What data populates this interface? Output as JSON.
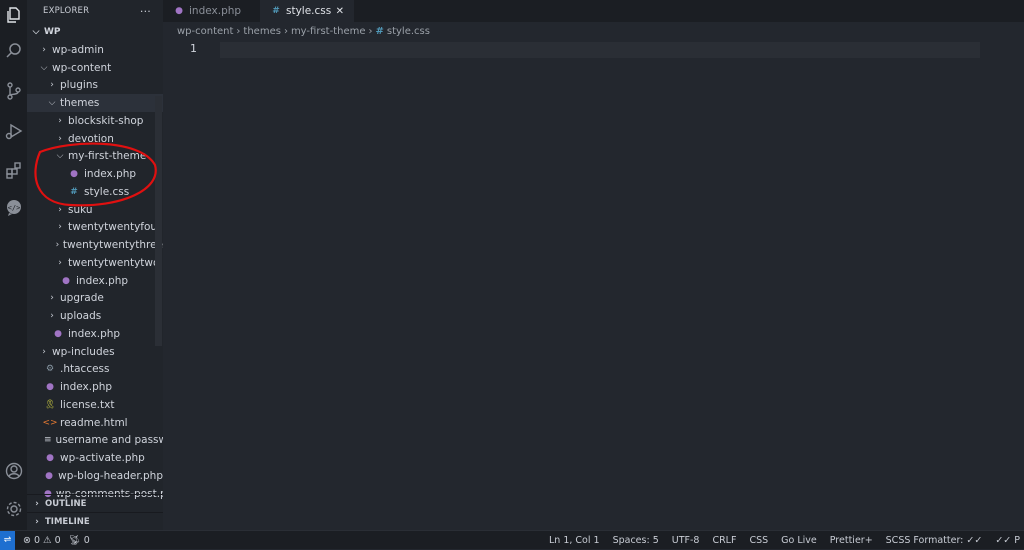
{
  "sidebar": {
    "title": "EXPLORER",
    "more": "···",
    "root": "WP",
    "items": [
      {
        "label": "wp-admin",
        "level": 1,
        "kind": "folder",
        "open": false
      },
      {
        "label": "wp-content",
        "level": 1,
        "kind": "folder",
        "open": true
      },
      {
        "label": "plugins",
        "level": 2,
        "kind": "folder",
        "open": false
      },
      {
        "label": "themes",
        "level": 2,
        "kind": "folder",
        "open": true,
        "selected": true
      },
      {
        "label": "blockskit-shop",
        "level": 3,
        "kind": "folder",
        "open": false
      },
      {
        "label": "devotion",
        "level": 3,
        "kind": "folder",
        "open": false
      },
      {
        "label": "my-first-theme",
        "level": 3,
        "kind": "folder",
        "open": true
      },
      {
        "label": "index.php",
        "level": 4,
        "kind": "php"
      },
      {
        "label": "style.css",
        "level": 4,
        "kind": "css"
      },
      {
        "label": "suku",
        "level": 3,
        "kind": "folder",
        "open": false
      },
      {
        "label": "twentytwentyfour",
        "level": 3,
        "kind": "folder",
        "open": false
      },
      {
        "label": "twentytwentythree",
        "level": 3,
        "kind": "folder",
        "open": false
      },
      {
        "label": "twentytwentytwo",
        "level": 3,
        "kind": "folder",
        "open": false
      },
      {
        "label": "index.php",
        "level": 3,
        "kind": "php"
      },
      {
        "label": "upgrade",
        "level": 2,
        "kind": "folder",
        "open": false
      },
      {
        "label": "uploads",
        "level": 2,
        "kind": "folder",
        "open": false
      },
      {
        "label": "index.php",
        "level": 2,
        "kind": "php"
      },
      {
        "label": "wp-includes",
        "level": 1,
        "kind": "folder",
        "open": false
      },
      {
        "label": ".htaccess",
        "level": 1,
        "kind": "gear"
      },
      {
        "label": "index.php",
        "level": 1,
        "kind": "php"
      },
      {
        "label": "license.txt",
        "level": 1,
        "kind": "lic"
      },
      {
        "label": "readme.html",
        "level": 1,
        "kind": "html"
      },
      {
        "label": "username and passw...",
        "level": 1,
        "kind": "txt"
      },
      {
        "label": "wp-activate.php",
        "level": 1,
        "kind": "php"
      },
      {
        "label": "wp-blog-header.php",
        "level": 1,
        "kind": "php"
      },
      {
        "label": "wp-comments-post.p",
        "level": 1,
        "kind": "php"
      }
    ],
    "outline": "OUTLINE",
    "timeline": "TIMELINE"
  },
  "tabs": [
    {
      "label": "index.php",
      "icon": "php"
    },
    {
      "label": "style.css",
      "icon": "css",
      "active": true
    }
  ],
  "breadcrumb": [
    "wp-content",
    "themes",
    "my-first-theme",
    "style.css"
  ],
  "editor": {
    "line_number": "1"
  },
  "status": {
    "errors": "0",
    "warnings": "0",
    "ports": "0",
    "right": [
      "Ln 1, Col 1",
      "Spaces: 5",
      "UTF-8",
      "CRLF",
      "CSS",
      "Go Live",
      "Prettier+",
      "SCSS Formatter: ✓✓",
      "✓✓ P"
    ]
  },
  "annotation_color": "#e01010"
}
